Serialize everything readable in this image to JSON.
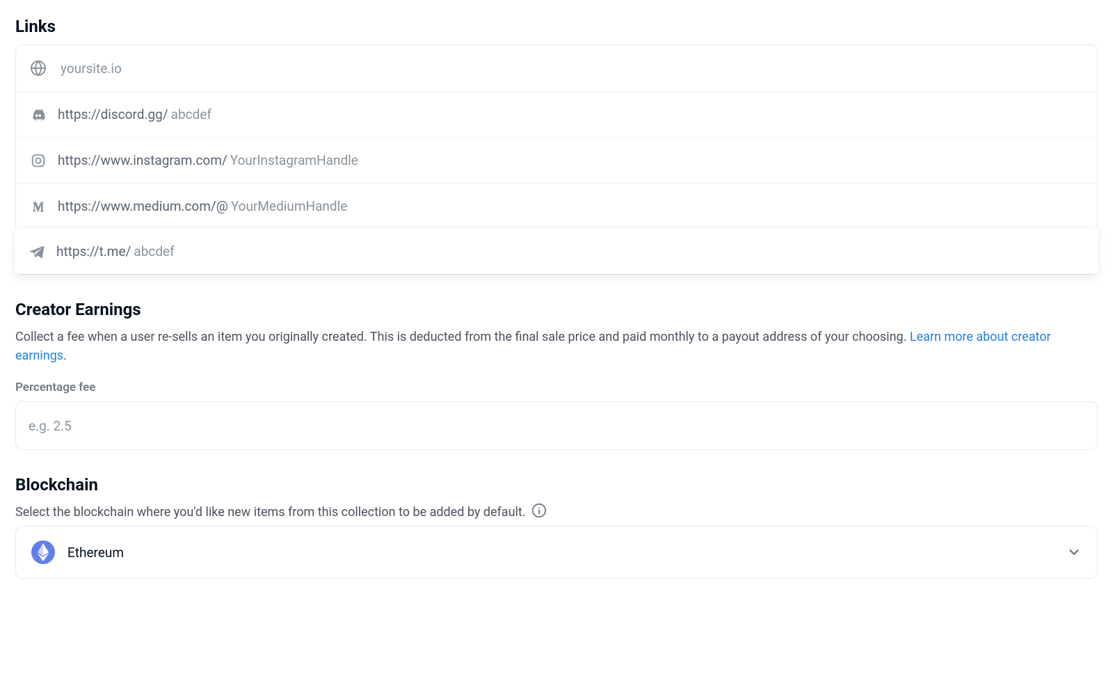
{
  "links": {
    "heading": "Links",
    "items": [
      {
        "id": "website",
        "icon": "globe",
        "prefix": "",
        "placeholder": "yoursite.io",
        "value": ""
      },
      {
        "id": "discord",
        "icon": "discord",
        "prefix": "https://discord.gg/",
        "placeholder": "abcdef",
        "value": ""
      },
      {
        "id": "instagram",
        "icon": "instagram",
        "prefix": "https://www.instagram.com/",
        "placeholder": "YourInstagramHandle",
        "value": ""
      },
      {
        "id": "medium",
        "icon": "medium",
        "prefix": "https://www.medium.com/@",
        "placeholder": "YourMediumHandle",
        "value": ""
      },
      {
        "id": "telegram",
        "icon": "telegram",
        "prefix": "https://t.me/",
        "placeholder": "abcdef",
        "value": "",
        "focused": true
      }
    ]
  },
  "earnings": {
    "heading": "Creator Earnings",
    "description": "Collect a fee when a user re-sells an item you originally created. This is deducted from the final sale price and paid monthly to a payout address of your choosing.",
    "learn_more": "Learn more about creator earnings",
    "fee_label": "Percentage fee",
    "fee_placeholder": "e.g. 2.5",
    "fee_value": ""
  },
  "blockchain": {
    "heading": "Blockchain",
    "description": "Select the blockchain where you'd like new items from this collection to be added by default.",
    "selected": "Ethereum"
  }
}
